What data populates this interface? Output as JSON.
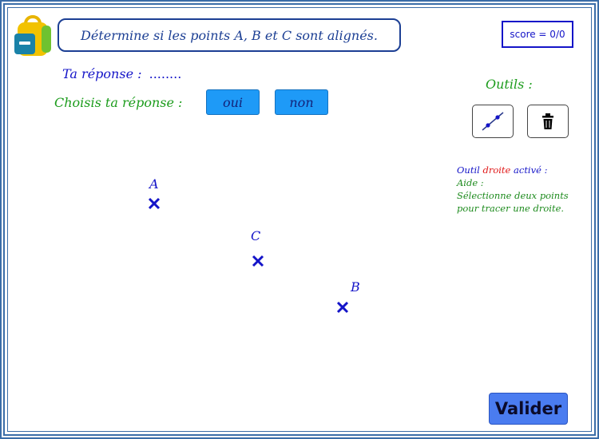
{
  "header": {
    "instruction": "Détermine si les points A, B et C sont alignés.",
    "score": "score = 0/0"
  },
  "answer": {
    "label": "Ta réponse :",
    "value": "........"
  },
  "choice": {
    "label": "Choisis ta réponse :",
    "options": [
      "oui",
      "non"
    ]
  },
  "tools": {
    "label": "Outils :",
    "items": [
      {
        "name": "line-tool",
        "icon": "line-through-points-icon"
      },
      {
        "name": "delete-tool",
        "icon": "trash-icon"
      }
    ]
  },
  "info": {
    "tool_prefix": "Outil",
    "tool_name": "droite",
    "tool_suffix": "activé :",
    "help_title": "Aide :",
    "help_line1": "Sélectionne deux points",
    "help_line2": "pour tracer une droite."
  },
  "points": [
    {
      "label": "A"
    },
    {
      "label": "C"
    },
    {
      "label": "B"
    }
  ],
  "validate_label": "Valider",
  "colors": {
    "border": "#3a6da8",
    "title": "#1c3f94",
    "blue_text": "#1414c8",
    "green_text": "#1c9c1c",
    "button": "#1e9af7",
    "validate": "#4a7cf0"
  }
}
